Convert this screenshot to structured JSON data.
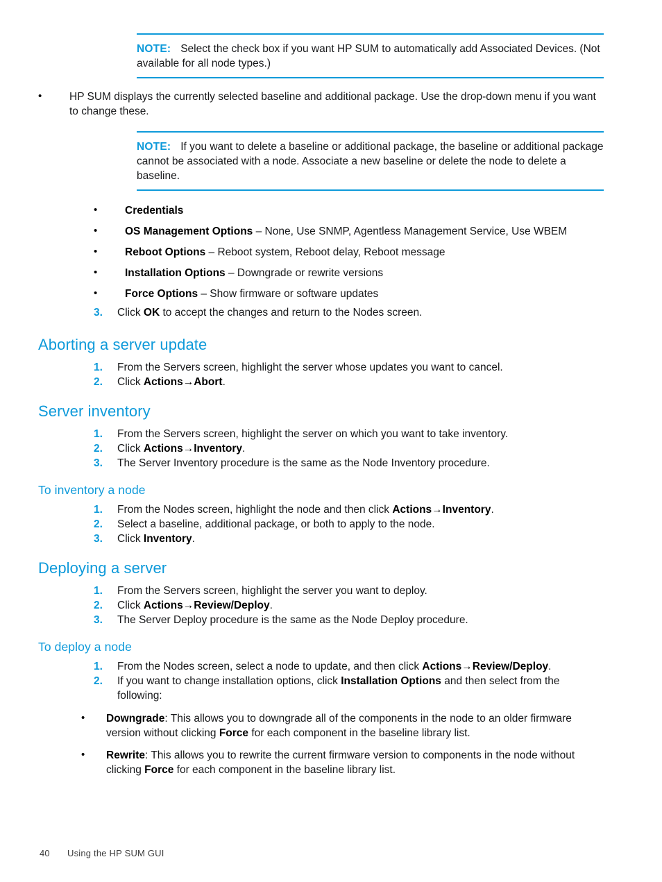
{
  "document": {
    "footer": {
      "page_number": "40",
      "chapter_title": "Using the HP SUM GUI"
    },
    "accent_color": "#0e9ada"
  },
  "notes": [
    {
      "label": "NOTE:",
      "text": "Select the check box if you want HP SUM to automatically add Associated Devices. (Not available for all node types.)"
    },
    {
      "label": "NOTE:",
      "text": "If you want to delete a baseline or additional package, the baseline or additional package cannot be associated with a node. Associate a new baseline or delete the node to delete a baseline."
    }
  ],
  "intro_bullet": {
    "text": "HP SUM displays the currently selected baseline and additional package. Use the drop-down menu if you want to change these."
  },
  "option_bullets": [
    {
      "term": "Credentials",
      "rest": ""
    },
    {
      "term": "OS Management Options",
      "rest": " – None, Use SNMP, Agentless Management Service, Use WBEM"
    },
    {
      "term": "Reboot Options",
      "rest": " – Reboot system, Reboot delay, Reboot message"
    },
    {
      "term": "Installation Options",
      "rest": " – Downgrade or rewrite versions"
    },
    {
      "term": "Force Options",
      "rest": " – Show firmware or software updates"
    }
  ],
  "step_ok": {
    "num": "3.",
    "pre": "Click ",
    "bold": "OK",
    "post": " to accept the changes and return to the Nodes screen."
  },
  "sections": [
    {
      "id": "aborting-a-server-update",
      "level": "h2",
      "heading": "Aborting a server update",
      "steps": [
        {
          "num": "1.",
          "pre": "From the Servers screen, highlight the server whose updates you want to cancel.",
          "bold": "",
          "post": ""
        },
        {
          "num": "2.",
          "pre": "Click ",
          "bold": "Actions→Abort",
          "post": "."
        }
      ]
    },
    {
      "id": "server-inventory",
      "level": "h2",
      "heading": "Server inventory",
      "steps": [
        {
          "num": "1.",
          "pre": "From the Servers screen, highlight the server on which you want to take inventory.",
          "bold": "",
          "post": ""
        },
        {
          "num": "2.",
          "pre": "Click ",
          "bold": "Actions→Inventory",
          "post": "."
        },
        {
          "num": "3.",
          "pre": "The Server Inventory procedure is the same as the Node Inventory procedure.",
          "bold": "",
          "post": ""
        }
      ]
    },
    {
      "id": "to-inventory-a-node",
      "level": "h3",
      "heading": "To inventory a node",
      "steps": [
        {
          "num": "1.",
          "pre": "From the Nodes screen, highlight the node and then click ",
          "bold": "Actions→Inventory",
          "post": "."
        },
        {
          "num": "2.",
          "pre": "Select a baseline, additional package, or both to apply to the node.",
          "bold": "",
          "post": ""
        },
        {
          "num": "3.",
          "pre": "Click ",
          "bold": "Inventory",
          "post": "."
        }
      ]
    },
    {
      "id": "deploying-a-server",
      "level": "h2",
      "heading": "Deploying a server",
      "steps": [
        {
          "num": "1.",
          "pre": "From the Servers screen, highlight the server you want to deploy.",
          "bold": "",
          "post": ""
        },
        {
          "num": "2.",
          "pre": "Click ",
          "bold": "Actions→Review/Deploy",
          "post": "."
        },
        {
          "num": "3.",
          "pre": "The Server Deploy procedure is the same as the Node Deploy procedure.",
          "bold": "",
          "post": ""
        }
      ]
    }
  ],
  "deploy_node": {
    "id": "to-deploy-a-node",
    "level": "h3",
    "heading": "To deploy a node",
    "step1": {
      "num": "1.",
      "pre": "From the Nodes screen, select a node to update, and then click ",
      "bold": "Actions→Review/Deploy",
      "post": "."
    },
    "step2": {
      "num": "2.",
      "pre": "If you want to change installation options, click ",
      "bold": "Installation Options",
      "post": " and then select from the following:"
    },
    "sub_bullets": [
      {
        "term": "Downgrade",
        "part1": ": This allows you to downgrade all of the components in the node to an older firmware version without clicking ",
        "bold2": "Force",
        "part2": " for each component in the baseline library list."
      },
      {
        "term": "Rewrite",
        "part1": ": This allows you to rewrite the current firmware version to components in the node without clicking ",
        "bold2": "Force",
        "part2": " for each component in the baseline library list."
      }
    ]
  }
}
